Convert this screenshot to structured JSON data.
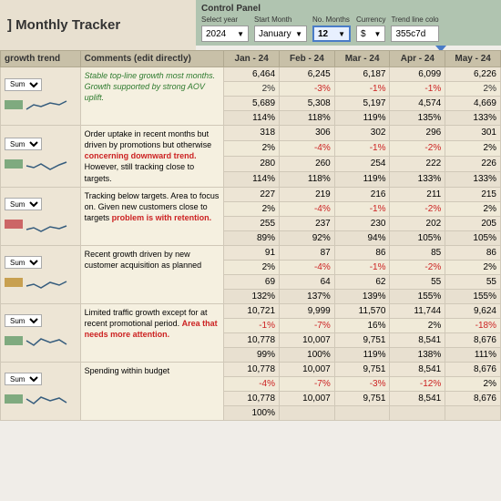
{
  "title": "] Monthly Tracker",
  "controlPanel": {
    "title": "Control Panel",
    "controls": [
      {
        "label": "Select year",
        "value": "2024",
        "arrow": "▼",
        "highlighted": false
      },
      {
        "label": "Start Month",
        "value": "January",
        "arrow": "▼",
        "highlighted": false
      },
      {
        "label": "No. Months",
        "value": "12",
        "arrow": "▼",
        "highlighted": true
      },
      {
        "label": "Currency",
        "value": "$",
        "arrow": "▼",
        "highlighted": false
      },
      {
        "label": "Trend line colo",
        "value": "355c7d",
        "arrow": ""
      }
    ]
  },
  "tableHeaders": [
    "growth trend",
    "Comments (edit directly)",
    "Jan - 24",
    "Feb - 24",
    "Mar - 24",
    "Apr - 24",
    "May - 24"
  ],
  "sections": [
    {
      "name": "Sum",
      "barColor": "#7faa7f",
      "sparkPoints": "5,15 12,10 20,12 28,8 38,10 48,6",
      "comment": "Stable top-line growth most months. Growth supported by strong AOV uplift.",
      "commentStyle": "green",
      "rows": [
        {
          "label": "",
          "values": [
            "6,464",
            "6,245",
            "6,187",
            "6,099",
            "6,226"
          ],
          "style": "normal"
        },
        {
          "label": "",
          "values": [
            "2%",
            "-3%",
            "-1%",
            "-1%",
            "2%"
          ],
          "style": "pct",
          "negatives": [
            1,
            2,
            3
          ]
        },
        {
          "label": "",
          "values": [
            "5,689",
            "5,308",
            "5,197",
            "4,574",
            "4,669"
          ],
          "style": "normal"
        },
        {
          "label": "",
          "values": [
            "114%",
            "118%",
            "119%",
            "135%",
            "133%"
          ],
          "style": "pct2"
        }
      ]
    },
    {
      "name": "Sum",
      "barColor": "#7faa7f",
      "sparkPoints": "5,12 12,14 20,10 28,16 38,11 48,8",
      "comment": "Order uptake in recent months but driven by promotions but otherwise concerning downward trend. However, still tracking close to targets.",
      "commentStyle": "mixed",
      "commentRed": "concerning downward trend.",
      "rows": [
        {
          "label": "",
          "values": [
            "318",
            "306",
            "302",
            "296",
            "301"
          ],
          "style": "normal"
        },
        {
          "label": "",
          "values": [
            "2%",
            "-4%",
            "-1%",
            "-2%",
            "2%"
          ],
          "style": "pct",
          "negatives": [
            1,
            2,
            3
          ]
        },
        {
          "label": "",
          "values": [
            "280",
            "260",
            "254",
            "222",
            "226"
          ],
          "style": "normal"
        },
        {
          "label": "",
          "values": [
            "114%",
            "118%",
            "119%",
            "133%",
            "133%"
          ],
          "style": "pct2"
        }
      ]
    },
    {
      "name": "Sum",
      "barColor": "#cc6666",
      "sparkPoints": "5,16 12,14 20,18 28,13 38,15 48,12",
      "comment": "Tracking below targets. Area to focus on. Given new customers close to targets problem is with retention.",
      "commentStyle": "mixed",
      "commentRed": "problem is with retention.",
      "rows": [
        {
          "label": "",
          "values": [
            "227",
            "219",
            "216",
            "211",
            "215"
          ],
          "style": "normal"
        },
        {
          "label": "",
          "values": [
            "2%",
            "-4%",
            "-1%",
            "-2%",
            "2%"
          ],
          "style": "pct",
          "negatives": [
            1,
            2,
            3
          ]
        },
        {
          "label": "",
          "values": [
            "255",
            "237",
            "230",
            "202",
            "205"
          ],
          "style": "normal"
        },
        {
          "label": "",
          "values": [
            "89%",
            "92%",
            "94%",
            "105%",
            "105%"
          ],
          "style": "pct2"
        }
      ]
    },
    {
      "name": "Sum",
      "barColor": "#c8a050",
      "sparkPoints": "5,14 12,12 20,16 28,10 38,13 48,9",
      "comment": "Recent growth driven by new customer acquisition as planned",
      "commentStyle": "normal",
      "rows": [
        {
          "label": "",
          "values": [
            "91",
            "87",
            "86",
            "85",
            "86"
          ],
          "style": "normal"
        },
        {
          "label": "",
          "values": [
            "2%",
            "-4%",
            "-1%",
            "-2%",
            "2%"
          ],
          "style": "pct",
          "negatives": [
            1,
            2,
            3
          ]
        },
        {
          "label": "",
          "values": [
            "69",
            "64",
            "62",
            "55",
            "55"
          ],
          "style": "normal"
        },
        {
          "label": "",
          "values": [
            "132%",
            "137%",
            "139%",
            "155%",
            "155%"
          ],
          "style": "pct2"
        }
      ]
    },
    {
      "name": "Sum",
      "barColor": "#7faa7f",
      "sparkPoints": "5,10 12,15 20,8 28,12 38,9 48,14",
      "comment": "Limited traffic growth except for at recent promotional period. Area that needs more attention.",
      "commentStyle": "mixed",
      "commentRed": "Area that needs more attention.",
      "rows": [
        {
          "label": "",
          "values": [
            "10,721",
            "9,999",
            "11,570",
            "11,744",
            "9,624"
          ],
          "style": "normal"
        },
        {
          "label": "",
          "values": [
            "-1%",
            "-7%",
            "16%",
            "2%",
            "-18%"
          ],
          "style": "pct",
          "negatives": [
            0,
            1,
            4
          ]
        },
        {
          "label": "",
          "values": [
            "10,778",
            "10,007",
            "9,751",
            "8,541",
            "8,676"
          ],
          "style": "normal"
        },
        {
          "label": "",
          "values": [
            "99%",
            "100%",
            "119%",
            "138%",
            "111%"
          ],
          "style": "pct2"
        }
      ]
    },
    {
      "name": "Sum",
      "barColor": "#7faa7f",
      "sparkPoints": "5,10 12,15 20,8 28,12 38,9 48,14",
      "comment": "Spending within budget",
      "commentStyle": "normal",
      "rows": [
        {
          "label": "",
          "values": [
            "10,778",
            "10,007",
            "9,751",
            "8,541",
            "8,676"
          ],
          "style": "normal"
        },
        {
          "label": "",
          "values": [
            "-4%",
            "-7%",
            "-3%",
            "-12%",
            "2%"
          ],
          "style": "pct",
          "negatives": [
            0,
            1,
            2,
            3
          ]
        },
        {
          "label": "",
          "values": [
            "10,778",
            "10,007",
            "9,751",
            "8,541",
            "8,676"
          ],
          "style": "normal"
        },
        {
          "label": "",
          "values": [
            "100%",
            "",
            "",
            "",
            ""
          ],
          "style": "pct2"
        }
      ]
    }
  ]
}
